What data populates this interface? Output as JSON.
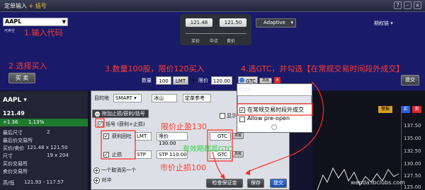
{
  "window": {
    "title": "定单输入",
    "title_suffix": "+ 括号"
  },
  "symbol_input": {
    "value": "AAPL",
    "subtext": "可卖空"
  },
  "quote": {
    "bid": "121.48",
    "ask": "121.50",
    "bid_label": "买价",
    "mid_label": "中点",
    "ask_label": "卖价"
  },
  "algo": {
    "value": "Adaptive"
  },
  "inbox": {
    "label": "期权链"
  },
  "annotations": {
    "step1": "1.输入代码",
    "step2": "2.选择买入",
    "step3": "3.数量100股，限价120买入",
    "step4": "4.选GTC，并勾选【在常规交易时间段外成交】",
    "take_profit": "限价止盈130",
    "gtc_note": "有效期都是GTC",
    "stop_loss": "市价止损100"
  },
  "action": {
    "buy_label": "买 卖",
    "submit_label": "提交"
  },
  "order_line": {
    "qty_label": "数量",
    "qty": "100",
    "type": "LMT",
    "limit_label": "限价",
    "limit_price": "120.00",
    "tif": "GTC"
  },
  "tif_menu": {
    "items": [
      "DAY",
      "GTC"
    ],
    "outside_rth_label": "在常规交易时段外成交",
    "preopen_label": "Allow pre-open"
  },
  "left_panel": {
    "symbol": "AAPL",
    "price": "121.49",
    "change": "+1.36",
    "change_pct": "1.13%",
    "stats": [
      {
        "label": "最后尺寸",
        "value": "2"
      },
      {
        "label": "最后价交易所",
        "value": ""
      },
      {
        "label": "买价/卖价",
        "value": "121.48 x 121.50"
      },
      {
        "label": "尺寸",
        "value": "19 x 204"
      },
      {
        "label": "买价交易所",
        "value": ""
      },
      {
        "label": "卖价交易所",
        "value": ""
      },
      {
        "label": "高/低",
        "value": "121.93 - 117.57"
      }
    ]
  },
  "dialog": {
    "dest_label": "目的地",
    "dest_value": "SMART",
    "iceberg": "冰山",
    "pref_label": "定单参考",
    "attach_label": "附加止损/获利/括号",
    "bracket_label": "括号 (获利+止损)",
    "tp_label": "获利回吐",
    "tp_type": "LMT",
    "tp_price_label": "限价",
    "tp_price": "130.00",
    "tp_tif": "GTC",
    "sl_label": "止损",
    "sl_type": "STP",
    "sl_price_label": "STP",
    "sl_price": "110.00",
    "sl_tif": "GTC",
    "adv_label": "高级",
    "oca_label": "一个取消另一个",
    "pair_label": "对冲",
    "check_margin": "检查保证金",
    "save_label": "保存",
    "transmit_label": "提交",
    "show_label": "显示"
  },
  "right_panel": {
    "alert_btn": "警报",
    "buy_btn": "买",
    "sell_btn": "卖",
    "yticks": [
      "137.50",
      "135.00",
      "132.50",
      "130.00",
      "127.50",
      "125.00"
    ],
    "watermark": "wenda.ibclubs.com"
  },
  "colors": {
    "annotation_red": "#ff3b30",
    "annotation_green": "#36d24a",
    "panel_blue": "#191a6a"
  }
}
